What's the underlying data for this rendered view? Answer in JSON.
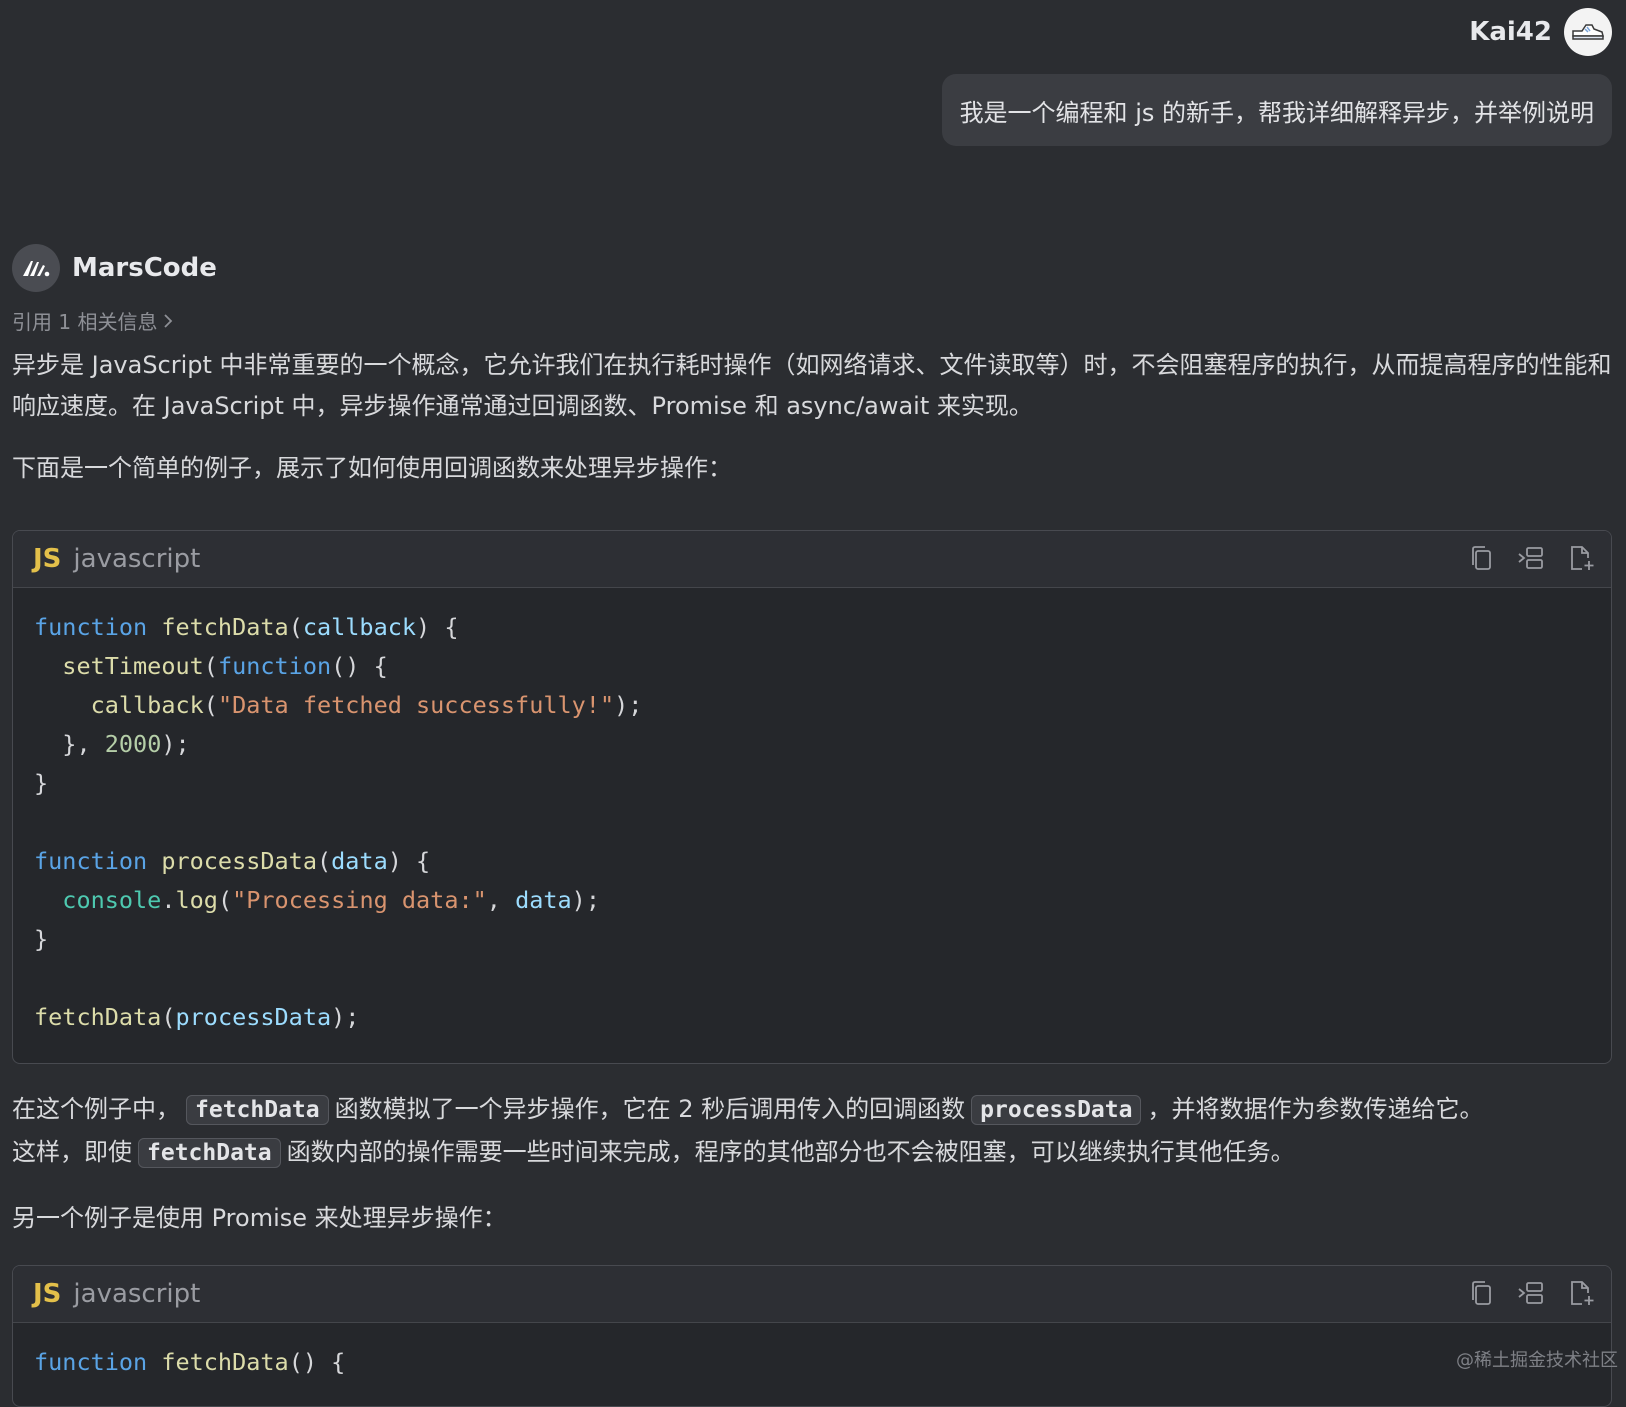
{
  "user": {
    "name": "Kai42",
    "message": "我是一个编程和 js 的新手，帮我详细解释异步，并举例说明"
  },
  "assistant": {
    "name": "MarsCode",
    "citation": "引用 1 相关信息",
    "intro_para": "异步是 JavaScript 中非常重要的一个概念，它允许我们在执行耗时操作（如网络请求、文件读取等）时，不会阻塞程序的执行，从而提高程序的性能和响应速度。在 JavaScript 中，异步操作通常通过回调函数、Promise 和 async/await 来实现。",
    "callback_intro": "下面是一个简单的例子，展示了如何使用回调函数来处理异步操作：",
    "explain": {
      "p1": "在这个例子中，",
      "c1": "fetchData",
      "p2": "函数模拟了一个异步操作，它在 2 秒后调用传入的回调函数",
      "c2": "processData",
      "p3": "，并将数据作为参数传递给它。",
      "p4": "这样，即使",
      "c3": "fetchData",
      "p5": "函数内部的操作需要一些时间来完成，程序的其他部分也不会被阻塞，可以继续执行其他任务。"
    },
    "promise_intro": "另一个例子是使用 Promise 来处理异步操作："
  },
  "code_blocks": [
    {
      "badge": "JS",
      "lang": "javascript",
      "code": "function fetchData(callback) {\n  setTimeout(function() {\n    callback(\"Data fetched successfully!\");\n  }, 2000);\n}\n\nfunction processData(data) {\n  console.log(\"Processing data:\", data);\n}\n\nfetchData(processData);"
    },
    {
      "badge": "JS",
      "lang": "javascript",
      "code": "function fetchData() {"
    }
  ],
  "icons": {
    "copy": "copy-icon",
    "insert": "insert-icon",
    "new_file": "new-file-icon",
    "chevron": "chevron-right-icon"
  },
  "colors": {
    "background": "#2b2d31",
    "bubble": "#3b3d42",
    "keyword": "#5aa4e6",
    "function": "#dcdcaa",
    "string": "#d9946f",
    "badge": "#e3c04a"
  },
  "watermark": "@稀土掘金技术社区"
}
